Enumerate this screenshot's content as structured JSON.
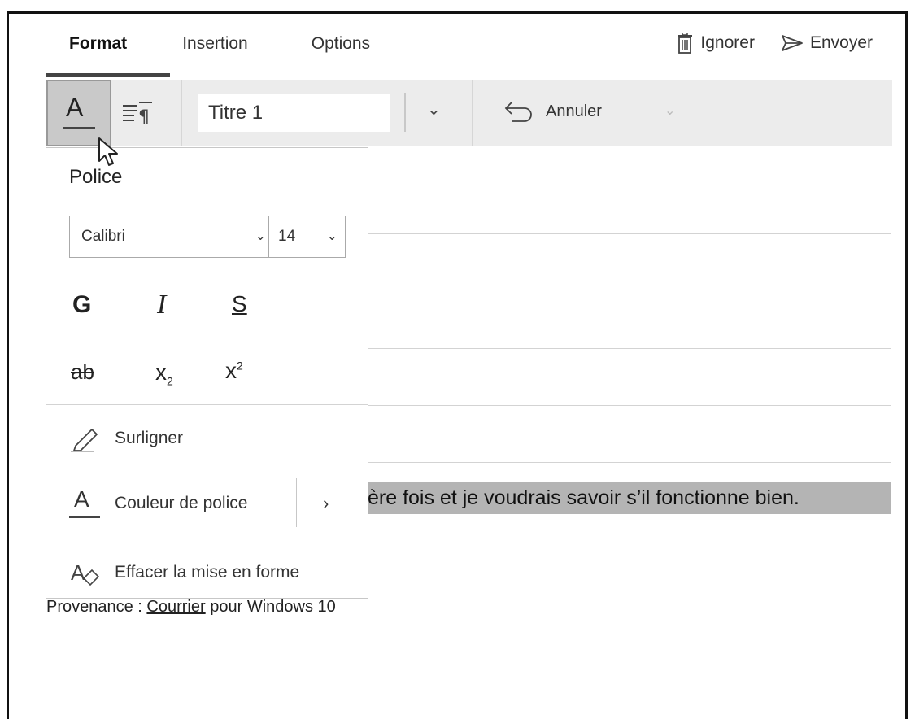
{
  "tabs": {
    "format": "Format",
    "insertion": "Insertion",
    "options": "Options"
  },
  "actions": {
    "discard": "Ignorer",
    "send": "Envoyer"
  },
  "toolbar": {
    "font_button": "A",
    "style_value": "Titre 1",
    "undo": "Annuler"
  },
  "font_panel": {
    "title": "Police",
    "font_name": "Calibri",
    "font_size": "14",
    "bold": "G",
    "italic": "I",
    "underline": "S",
    "strikethrough": "ab",
    "subscript_base": "x",
    "subscript_sub": "2",
    "superscript_base": "x",
    "superscript_sup": "2",
    "highlight": "Surligner",
    "font_color_icon": "A",
    "font_color": "Couleur de police",
    "clear_formatting": "Effacer la mise en forme"
  },
  "message": {
    "body_line": "ère fois et je voudrais savoir s’il fonctionne bien.",
    "footer_prefix": "Provenance : ",
    "footer_link": "Courrier",
    "footer_suffix": " pour Windows 10"
  }
}
